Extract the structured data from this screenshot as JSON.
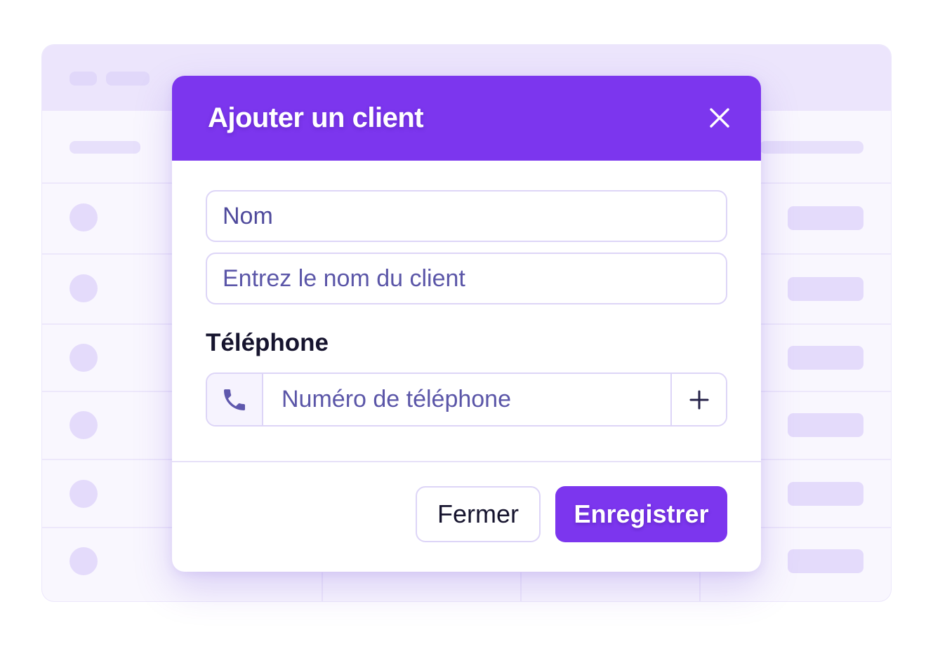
{
  "dialog": {
    "title": "Ajouter un client",
    "close_icon": "close-icon"
  },
  "form": {
    "name_field": {
      "value": "Nom"
    },
    "name_input": {
      "placeholder": "Entrez le nom du client"
    },
    "phone": {
      "label": "Téléphone",
      "prefix_icon": "phone-icon",
      "placeholder": "Numéro de téléphone",
      "add_icon": "plus-icon"
    }
  },
  "footer": {
    "close_label": "Fermer",
    "save_label": "Enregistrer"
  },
  "colors": {
    "accent": "#7c36ee",
    "border": "#ddd5f7",
    "placeholder": "#5b56a8",
    "text_dark": "#16142e",
    "background_skeleton": "#ece5fc"
  }
}
